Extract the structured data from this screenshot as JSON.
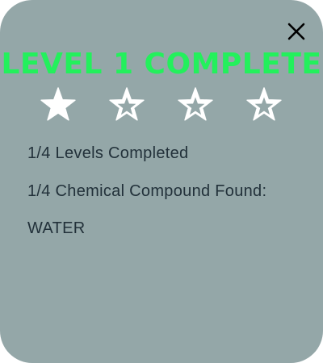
{
  "dialog": {
    "title": "LEVEL 1 COMPLETE",
    "title_color": "#23f05c",
    "background_color": "#94a7a8",
    "close_icon": "close-icon"
  },
  "rating": {
    "earned": 1,
    "total": 4,
    "icon": "star-icon"
  },
  "info": {
    "levels_completed": "1/4 Levels Completed",
    "compounds_found": "1/4 Chemical Compound Found:",
    "compound_name": "WATER"
  }
}
